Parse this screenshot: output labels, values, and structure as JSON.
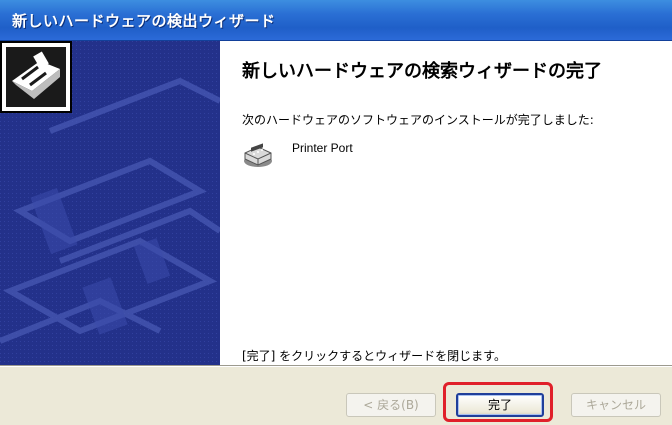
{
  "window": {
    "title": "新しいハードウェアの検出ウィザード"
  },
  "wizard": {
    "heading": "新しいハードウェアの検索ウィザードの完了",
    "message": "次のハードウェアのソフトウェアのインストールが完了しました:",
    "device": {
      "name": "Printer Port",
      "icon": "printer-port-icon"
    },
    "footer_instruction": "[完了] をクリックするとウィザードを閉じます。"
  },
  "buttons": {
    "back_label": "< 戻る(B)",
    "finish_label": "完了",
    "cancel_label": "キャンセル"
  },
  "colors": {
    "titlebar": "#2a6fd4",
    "side_panel": "#23318a",
    "button_bar": "#ece9d8",
    "highlight": "#e0202a"
  }
}
